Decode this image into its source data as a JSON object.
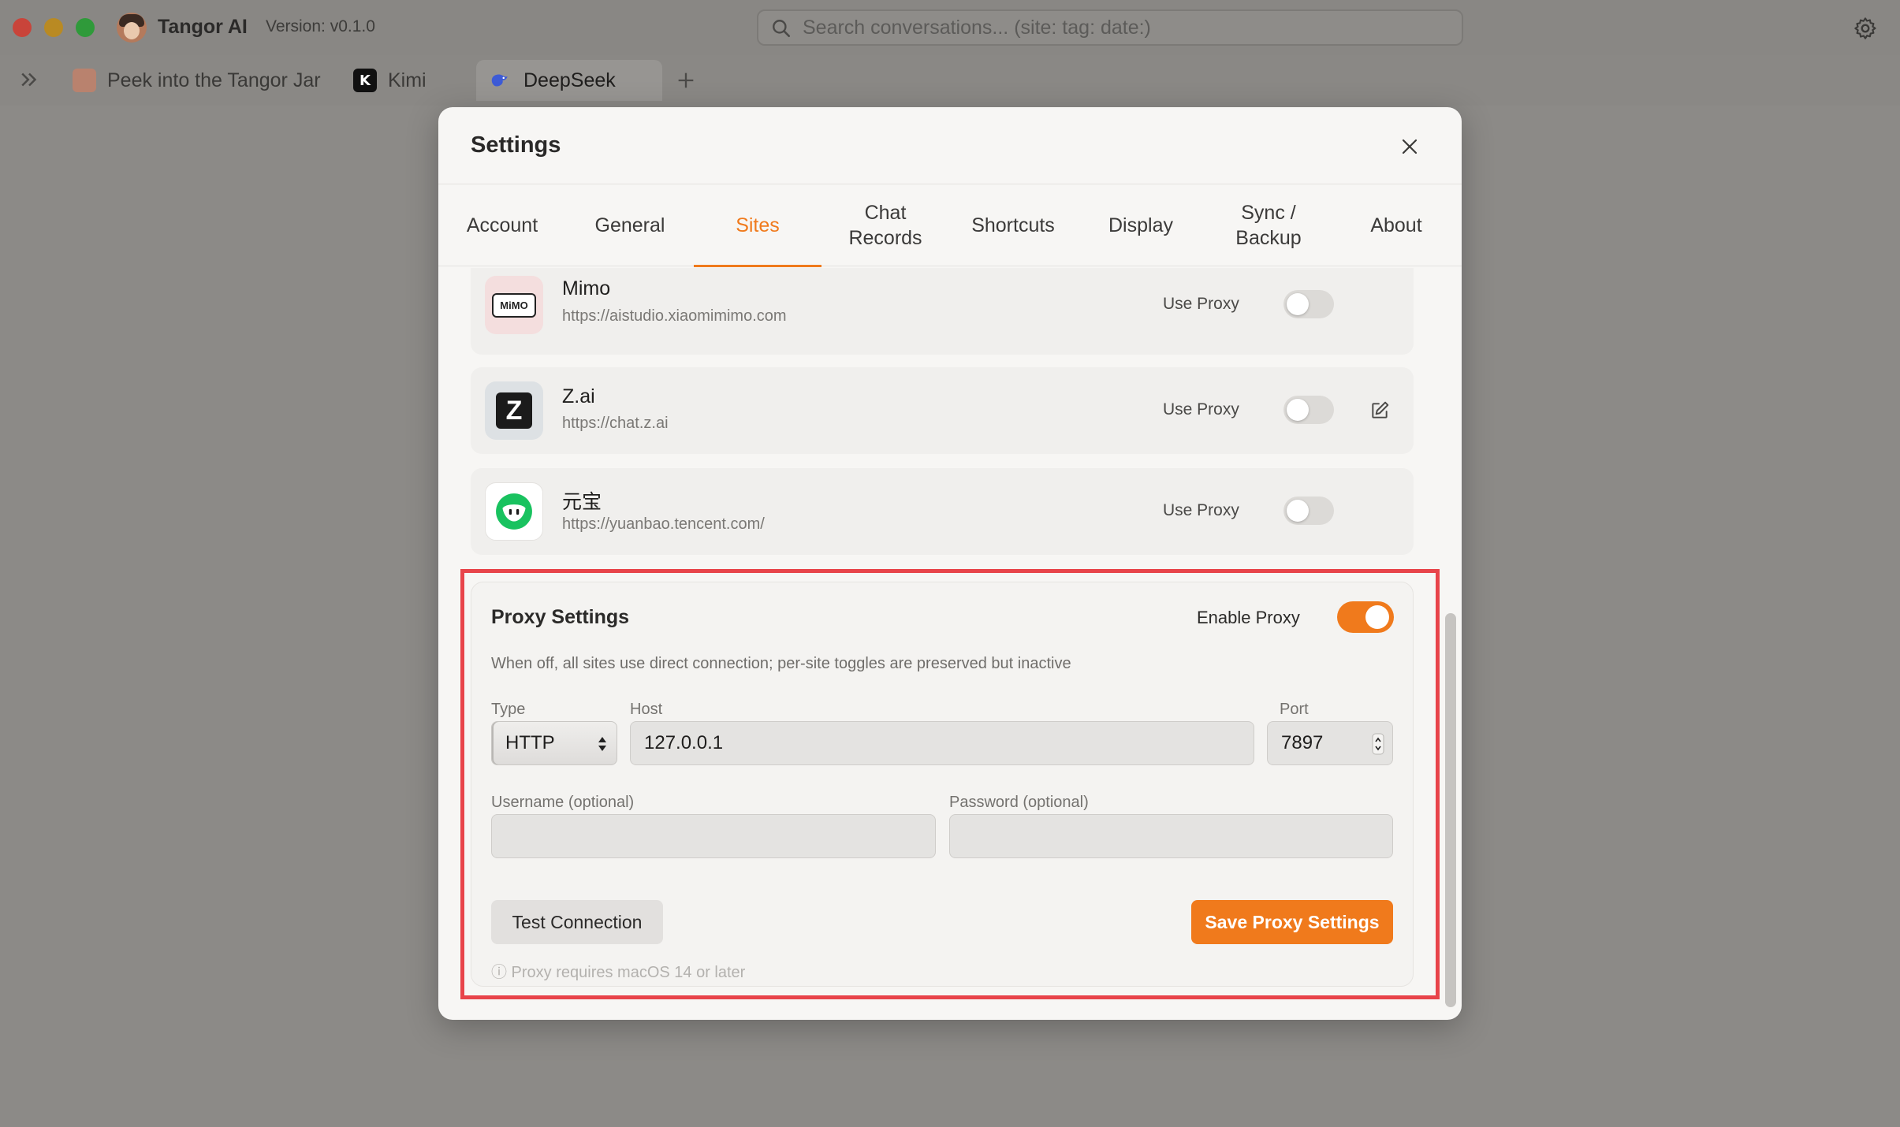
{
  "window": {
    "app_name": "Tangor AI",
    "version": "Version: v0.1.0",
    "search_placeholder": "Search conversations... (site: tag: date:)"
  },
  "tabs": [
    {
      "label": "Peek into the Tangor Jar",
      "icon": "tangor-logo-icon"
    },
    {
      "label": "Kimi",
      "icon": "kimi-logo-icon",
      "icon_text": "K"
    },
    {
      "label": "DeepSeek",
      "icon": "deepseek-logo-icon",
      "active": true
    }
  ],
  "settings": {
    "title": "Settings",
    "tabs": [
      {
        "label": "Account"
      },
      {
        "label": "General"
      },
      {
        "label": "Sites",
        "active": true
      },
      {
        "label": "Chat\nRecords"
      },
      {
        "label": "Shortcuts"
      },
      {
        "label": "Display"
      },
      {
        "label": "Sync /\nBackup"
      },
      {
        "label": "About"
      }
    ],
    "sites": [
      {
        "name": "Mimo",
        "url": "https://aistudio.xiaomimimo.com",
        "proxy_label": "Use Proxy",
        "use_proxy": false,
        "logo_text": "MiMO"
      },
      {
        "name": "Z.ai",
        "url": "https://chat.z.ai",
        "proxy_label": "Use Proxy",
        "use_proxy": false,
        "logo_text": "Z"
      },
      {
        "name": "元宝",
        "url": "https://yuanbao.tencent.com/",
        "proxy_label": "Use Proxy",
        "use_proxy": false
      }
    ],
    "proxy": {
      "title": "Proxy Settings",
      "enable_label": "Enable Proxy",
      "enabled": true,
      "description": "When off, all sites use direct connection; per-site toggles are preserved but inactive",
      "type_label": "Type",
      "type_value": "HTTP",
      "host_label": "Host",
      "host_value": "127.0.0.1",
      "port_label": "Port",
      "port_value": "7897",
      "username_label": "Username (optional)",
      "username_value": "",
      "password_label": "Password (optional)",
      "password_value": "",
      "test_button": "Test Connection",
      "save_button": "Save Proxy Settings",
      "note": "ⓘ Proxy requires macOS 14 or later"
    }
  },
  "colors": {
    "accent": "#f07a1c",
    "highlight": "#e8444a"
  }
}
